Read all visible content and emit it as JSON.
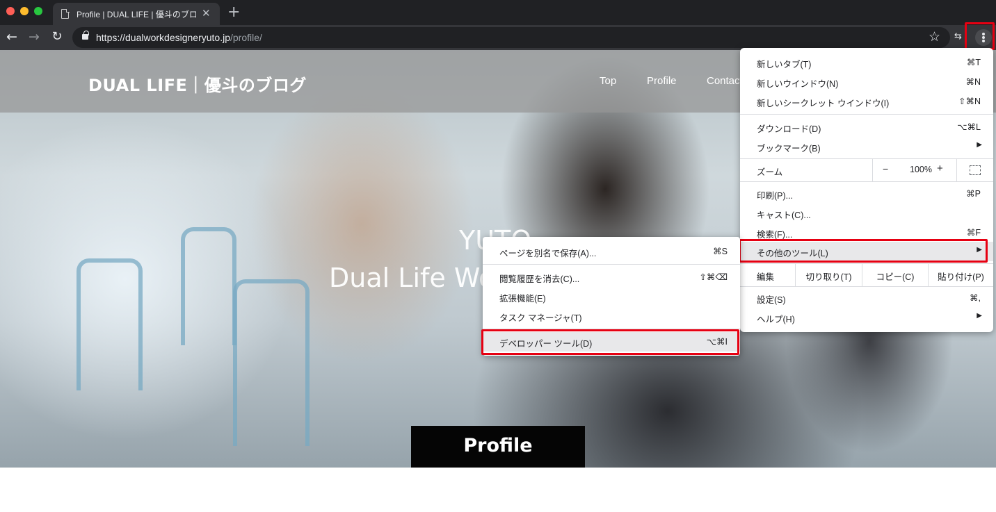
{
  "window": {
    "tab_title": "Profile | DUAL LIFE | 優斗のブログ",
    "close_glyph": "✕",
    "new_tab_glyph": "+"
  },
  "toolbar": {
    "back_glyph": "←",
    "forward_glyph": "→",
    "reload_glyph": "↻",
    "url_host": "https://dualworkdesigneryuto.jp",
    "url_path": "/profile/",
    "star_glyph": "☆",
    "extension_glyph": "⇆"
  },
  "site": {
    "title": "DUAL LIFE｜優斗のブログ",
    "nav": [
      "Top",
      "Profile",
      "Contact"
    ],
    "hero_name": "YUTO",
    "hero_subtitle": "Dual Life Worker",
    "profile_label": "Profile"
  },
  "menu": {
    "new_tab": {
      "label": "新しいタブ(T)",
      "shortcut": "⌘T"
    },
    "new_window": {
      "label": "新しいウインドウ(N)",
      "shortcut": "⌘N"
    },
    "incognito": {
      "label": "新しいシークレット ウインドウ(I)",
      "shortcut": "⇧⌘N"
    },
    "downloads": {
      "label": "ダウンロード(D)",
      "shortcut": "⌥⌘L"
    },
    "bookmarks": {
      "label": "ブックマーク(B)"
    },
    "zoom": {
      "label": "ズーム",
      "minus": "−",
      "value": "100%",
      "plus": "+"
    },
    "print": {
      "label": "印刷(P)...",
      "shortcut": "⌘P"
    },
    "cast": {
      "label": "キャスト(C)..."
    },
    "find": {
      "label": "検索(F)...",
      "shortcut": "⌘F"
    },
    "more_tools": {
      "label": "その他のツール(L)"
    },
    "edit": {
      "label": "編集",
      "cut": "切り取り(T)",
      "copy": "コピー(C)",
      "paste": "貼り付け(P)"
    },
    "settings": {
      "label": "設定(S)",
      "shortcut": "⌘,"
    },
    "help": {
      "label": "ヘルプ(H)"
    },
    "submenu_arrow": "▶"
  },
  "submenu": {
    "save_page": {
      "label": "ページを別名で保存(A)...",
      "shortcut": "⌘S"
    },
    "clear_history": {
      "label": "閲覧履歴を消去(C)...",
      "shortcut": "⇧⌘⌫"
    },
    "extensions": {
      "label": "拡張機能(E)"
    },
    "task_manager": {
      "label": "タスク マネージャ(T)"
    },
    "developer_tools": {
      "label": "デベロッパー ツール(D)",
      "shortcut": "⌥⌘I"
    }
  },
  "colors": {
    "highlight": "#e60012",
    "chrome_dark": "#202124",
    "chrome_toolbar": "#35363a"
  }
}
